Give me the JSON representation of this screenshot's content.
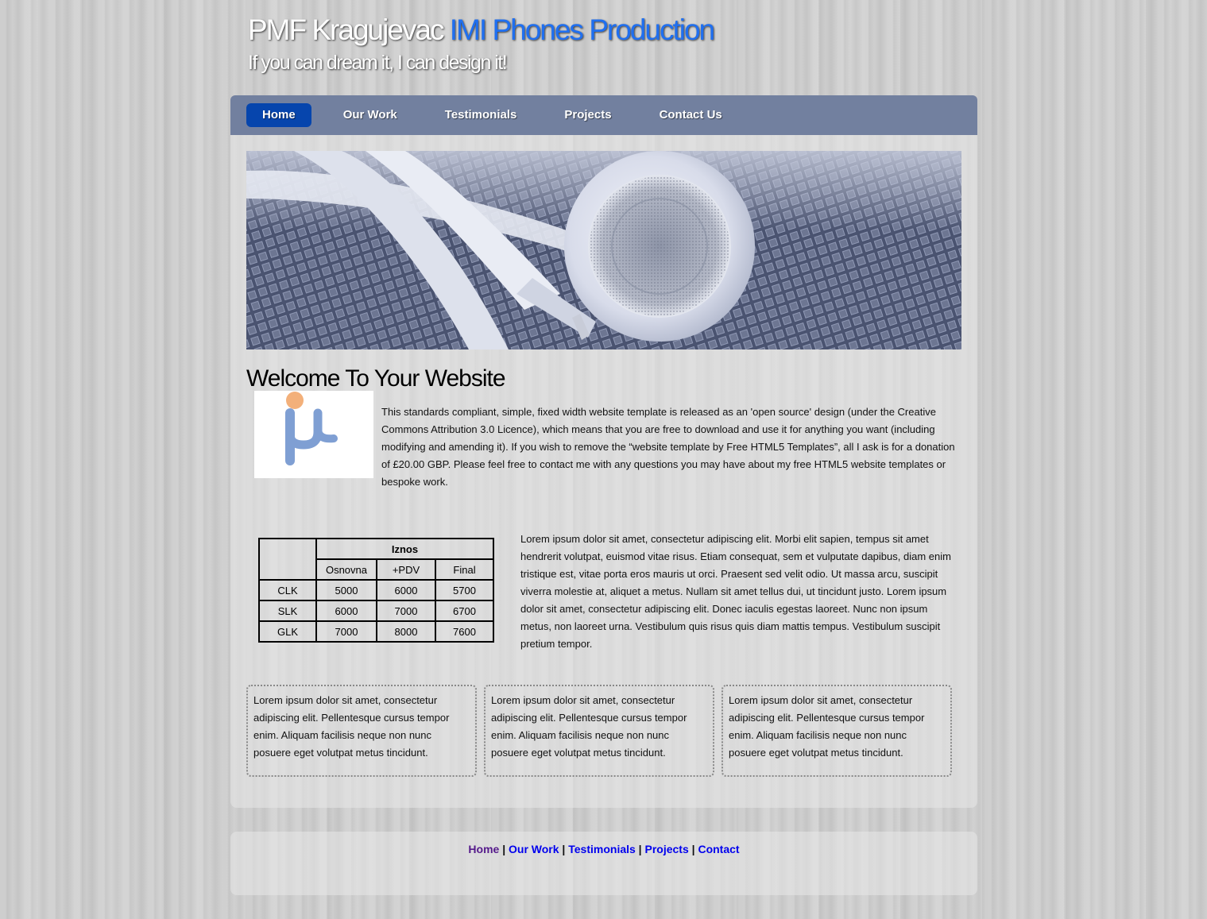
{
  "header": {
    "title_main": "PMF Kragujevac",
    "title_accent": "IMI Phones Production",
    "slogan": "If you can dream it, I can design it!"
  },
  "menu": {
    "items": [
      {
        "label": "Home",
        "selected": true
      },
      {
        "label": "Our Work"
      },
      {
        "label": "Testimonials"
      },
      {
        "label": "Projects"
      },
      {
        "label": "Contact Us"
      }
    ]
  },
  "banner": {
    "icon": "earphones-photo"
  },
  "content": {
    "heading": "Welcome To Your Website",
    "logo_icon": "mu-logo",
    "intro": "This standards compliant, simple, fixed width website template is released as an 'open source' design (under the Creative Commons Attribution 3.0 Licence), which means that you are free to download and use it for anything you want (including modifying and amending it). If you wish to remove the “website template by Free HTML5 Templates”, all I ask is for a donation of £20.00 GBP. Please feel free to contact me with any questions you may have about my free HTML5 website templates or bespoke work.",
    "table": {
      "group_header": "Iznos",
      "columns": [
        "Osnovna",
        "+PDV",
        "Final"
      ],
      "rows": [
        {
          "name": "CLK",
          "values": [
            "5000",
            "6000",
            "5700"
          ]
        },
        {
          "name": "SLK",
          "values": [
            "6000",
            "7000",
            "6700"
          ]
        },
        {
          "name": "GLK",
          "values": [
            "7000",
            "8000",
            "7600"
          ]
        }
      ]
    },
    "lorem_main": "Lorem ipsum dolor sit amet, consectetur adipiscing elit. Morbi elit sapien, tempus sit amet hendrerit volutpat, euismod vitae risus. Etiam consequat, sem et vulputate dapibus, diam enim tristique est, vitae porta eros mauris ut orci. Praesent sed velit odio. Ut massa arcu, suscipit viverra molestie at, aliquet a metus. Nullam sit amet tellus dui, ut tincidunt justo. Lorem ipsum dolor sit amet, consectetur adipiscing elit. Donec iaculis egestas laoreet. Nunc non ipsum metus, non laoreet urna. Vestibulum quis risus quis diam mattis tempus. Vestibulum suscipit pretium tempor.",
    "boxes": [
      "Lorem ipsum dolor sit amet, consectetur adipiscing elit. Pellentesque cursus tempor enim. Aliquam facilisis neque non nunc posuere eget volutpat metus tincidunt.",
      "Lorem ipsum dolor sit amet, consectetur adipiscing elit. Pellentesque cursus tempor enim. Aliquam facilisis neque non nunc posuere eget volutpat metus tincidunt.",
      "Lorem ipsum dolor sit amet, consectetur adipiscing elit. Pellentesque cursus tempor enim. Aliquam facilisis neque non nunc posuere eget volutpat metus tincidunt."
    ]
  },
  "footer": {
    "links": [
      "Home",
      "Our Work",
      "Testimonials",
      "Projects",
      "Contact"
    ],
    "separator": " | "
  },
  "colors": {
    "accent": "#1f6ff0",
    "menubar": "#72809f",
    "menu_selected": "#0645ad",
    "link": "#0000ee",
    "link_visited": "#551a8b"
  }
}
